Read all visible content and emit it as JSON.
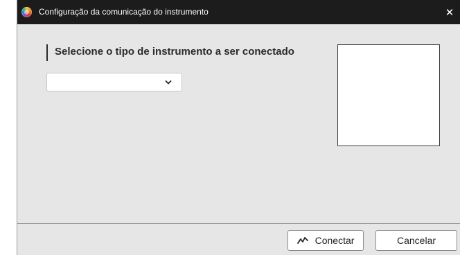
{
  "window": {
    "title": "Configuração da comunicação do instrumento",
    "close_symbol": "✕",
    "app_icon": "color-wheel-icon"
  },
  "main": {
    "heading": "Selecione o tipo de instrumento a ser conectado",
    "instrument_select": {
      "value": "",
      "chevron_icon": "chevron-down-icon"
    }
  },
  "footer": {
    "connect_label": "Conectar",
    "connect_icon": "pulse-icon",
    "cancel_label": "Cancelar"
  }
}
